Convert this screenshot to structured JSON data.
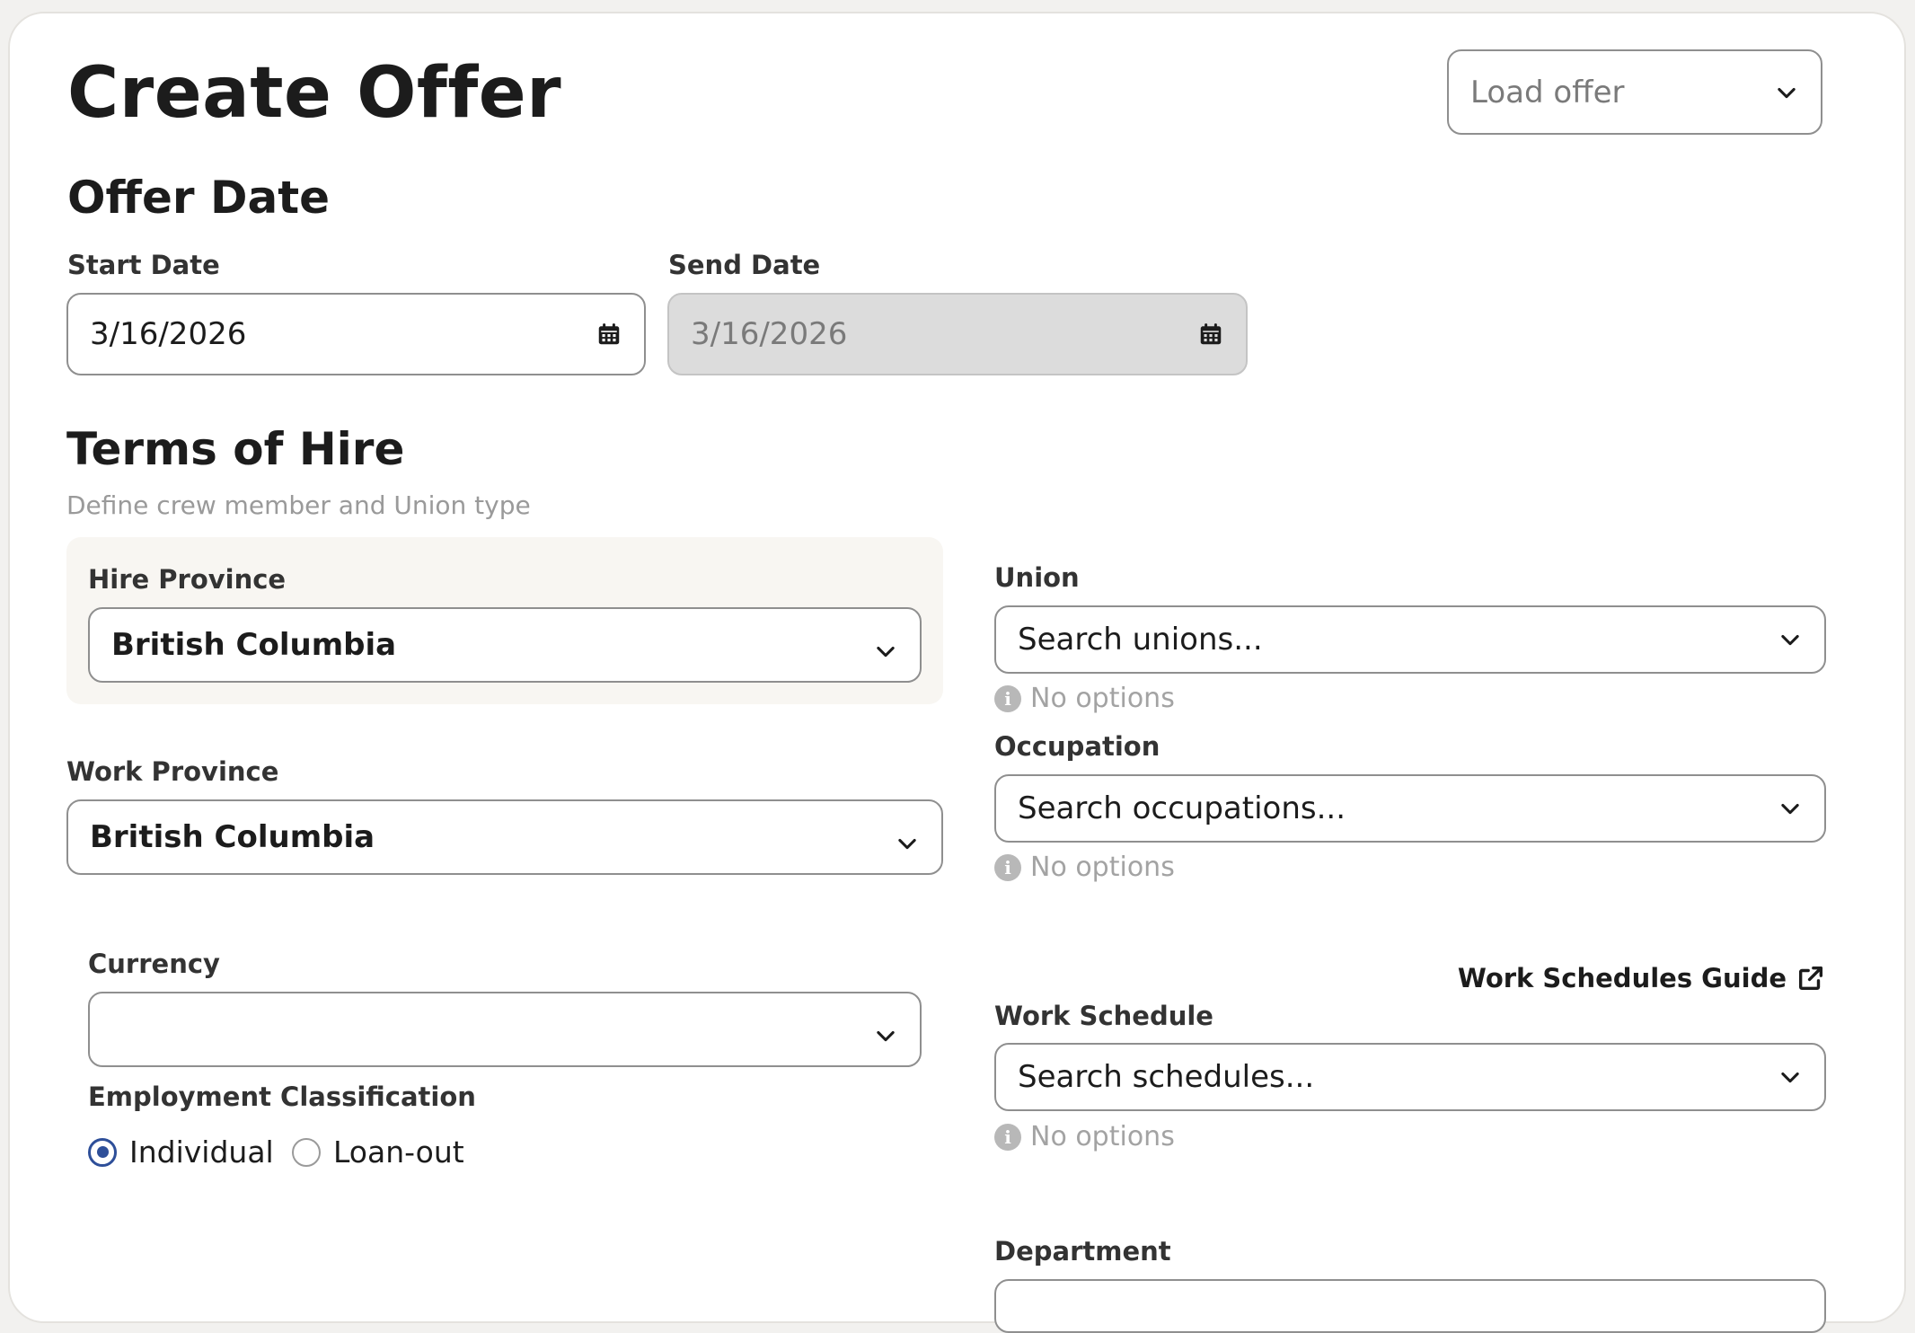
{
  "header": {
    "title": "Create Offer",
    "load_offer": {
      "placeholder": "Load offer"
    }
  },
  "offer_date": {
    "title": "Offer Date",
    "start_date": {
      "label": "Start Date",
      "value": "3/16/2026"
    },
    "send_date": {
      "label": "Send Date",
      "value": "3/16/2026"
    }
  },
  "terms": {
    "title": "Terms of Hire",
    "subtitle": "Define crew member and Union type",
    "hire_province": {
      "label": "Hire Province",
      "value": "British Columbia"
    },
    "work_province": {
      "label": "Work Province",
      "value": "British Columbia"
    },
    "currency": {
      "label": "Currency",
      "value": ""
    },
    "employment_classification": {
      "label": "Employment Classification",
      "options": [
        {
          "label": "Individual",
          "checked": true
        },
        {
          "label": "Loan-out",
          "checked": false
        }
      ]
    },
    "union": {
      "label": "Union",
      "placeholder": "Search unions...",
      "hint": "No options"
    },
    "occupation": {
      "label": "Occupation",
      "placeholder": "Search occupations...",
      "hint": "No options"
    },
    "work_schedule": {
      "label": "Work Schedule",
      "guide_link": "Work Schedules Guide",
      "placeholder": "Search schedules...",
      "hint": "No options"
    },
    "department": {
      "label": "Department"
    }
  },
  "icons": {
    "chevron": "chevron-down-icon",
    "calendar": "calendar-icon",
    "info": "info-icon",
    "external_link": "external-link-icon"
  },
  "colors": {
    "accent": "#2e4f99",
    "hire_box_bg": "#f8f6f2",
    "disabled_bg": "#dcdcdc"
  }
}
